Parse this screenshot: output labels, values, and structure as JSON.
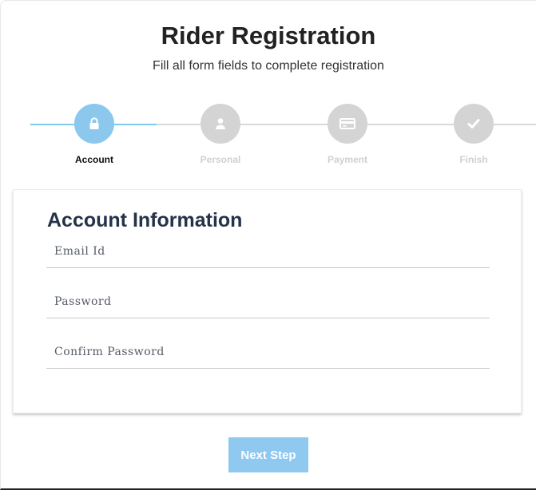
{
  "header": {
    "title": "Rider Registration",
    "subtitle": "Fill all form fields to complete registration"
  },
  "progress": {
    "active_step": 0,
    "accent_color": "#8cc8ee",
    "inactive_color": "#d4d4d4",
    "steps": [
      {
        "label": "Account",
        "icon": "lock-icon",
        "state": "active"
      },
      {
        "label": "Personal",
        "icon": "user-icon",
        "state": "inactive"
      },
      {
        "label": "Payment",
        "icon": "credit-card-icon",
        "state": "inactive"
      },
      {
        "label": "Finish",
        "icon": "check-icon",
        "state": "inactive"
      }
    ]
  },
  "form": {
    "title": "Account Information",
    "fields": [
      {
        "placeholder": "Email Id",
        "value": "",
        "type": "email"
      },
      {
        "placeholder": "Password",
        "value": "",
        "type": "password"
      },
      {
        "placeholder": "Confirm Password",
        "value": "",
        "type": "password"
      }
    ]
  },
  "actions": {
    "next_label": "Next Step"
  }
}
